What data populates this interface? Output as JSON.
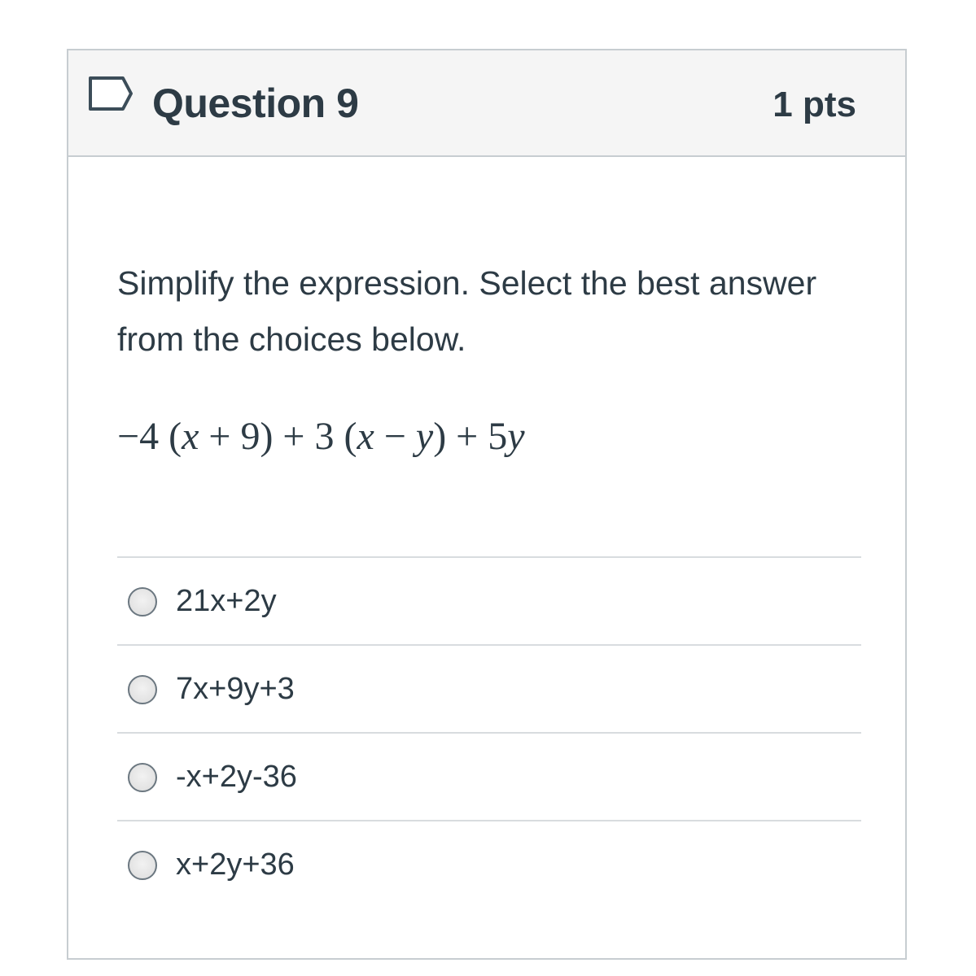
{
  "question": {
    "title": "Question 9",
    "points": "1 pts",
    "prompt": "Simplify the expression. Select the best answer from the choices below.",
    "expression": {
      "parts": [
        "−4 (",
        "x",
        " + 9) + 3 (",
        "x",
        " − ",
        "y",
        ") + 5",
        "y"
      ]
    }
  },
  "answers": [
    {
      "label": "21x+2y"
    },
    {
      "label": "7x+9y+3"
    },
    {
      "label": "-x+2y-36"
    },
    {
      "label": "x+2y+36"
    }
  ],
  "colors": {
    "text": "#2d3b45",
    "header_bg": "#f5f5f5",
    "border": "#c7cdd1",
    "flag_icon": "#2b7abc"
  },
  "icons": {
    "flag": "flag-outline-icon"
  }
}
